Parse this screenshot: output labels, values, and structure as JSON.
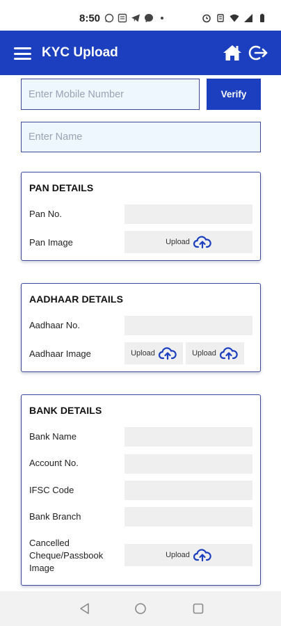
{
  "status_bar": {
    "time": "8:50",
    "left_icons": [
      "whatsapp-icon",
      "news-icon",
      "telegram-icon",
      "messenger-icon",
      "dot-icon"
    ],
    "right_icons": [
      "alarm-icon",
      "vibrate-icon",
      "wifi-icon",
      "signal-icon",
      "battery-icon"
    ]
  },
  "app_bar": {
    "title": "KYC Upload",
    "background": "#1b3fbf",
    "icons": [
      "menu-icon",
      "home-icon",
      "logout-icon"
    ]
  },
  "form": {
    "mobile": {
      "placeholder": "Enter Mobile Number",
      "value": ""
    },
    "verify_label": "Verify",
    "name": {
      "placeholder": "Enter Name",
      "value": ""
    }
  },
  "pan": {
    "title": "PAN DETAILS",
    "number_label": "Pan No.",
    "image_label": "Pan Image",
    "upload_label": "Upload"
  },
  "aadhaar": {
    "title": "AADHAAR DETAILS",
    "number_label": "Aadhaar No.",
    "image_label": "Aadhaar Image",
    "upload_front_label": "Upload",
    "upload_back_label": "Upload"
  },
  "bank": {
    "title": "BANK DETAILS",
    "bank_name_label": "Bank Name",
    "account_label": "Account No.",
    "ifsc_label": "IFSC Code",
    "branch_label": "Bank Branch",
    "cheque_label_line1": "Cancelled",
    "cheque_label_line2": "Cheque/Passbook",
    "cheque_label_line3": "Image",
    "upload_label": "Upload"
  },
  "nav_bar": {
    "icons": [
      "back-icon",
      "home-circle-icon",
      "recents-icon"
    ]
  }
}
